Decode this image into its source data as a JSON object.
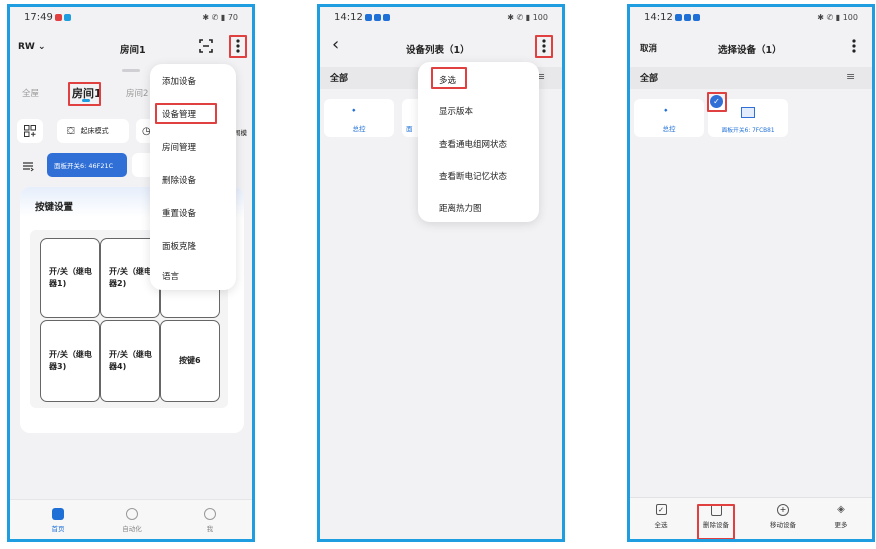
{
  "screen1": {
    "status_time": "17:49",
    "status_right": "✱ ✆ ▮ 70",
    "rw_label": "RW",
    "title": "房间1",
    "tabs": [
      "全屋",
      "房间1",
      "房间2"
    ],
    "mode_label": "起床模式",
    "mode_label_partial": "闹模",
    "device_chip": "面板开关6: 46F21C",
    "section_title": "按键设置",
    "tiles": [
      "开/关（继电器1)",
      "开/关（继电器2)",
      "开/关（继电器3)",
      "开/关（继电器4)",
      "按键6"
    ],
    "menu": [
      "添加设备",
      "设备管理",
      "房间管理",
      "删除设备",
      "重置设备",
      "面板克隆",
      "语言"
    ],
    "nav": [
      "首页",
      "自动化",
      "我"
    ]
  },
  "screen2": {
    "status_time": "14:12",
    "status_right": "✱ ✆ ▮ 100",
    "title": "设备列表（1）",
    "filter_label": "全部",
    "device_master": "总控",
    "device_partial": "面",
    "menu": [
      "多选",
      "显示版本",
      "查看通电组网状态",
      "查看断电记忆状态",
      "距离热力图"
    ]
  },
  "screen3": {
    "status_time": "14:12",
    "status_right": "✱ ✆ ▮ 100",
    "cancel_label": "取消",
    "title": "选择设备（1）",
    "filter_label": "全部",
    "device_master": "总控",
    "device_panel": "面板开关6: 7FCB81",
    "toolbar": [
      "全选",
      "删除设备",
      "移动设备",
      "更多"
    ]
  },
  "colors": {
    "accent": "#1e9de0",
    "highlight": "#e04040",
    "chip_blue": "#2f6fd6"
  }
}
